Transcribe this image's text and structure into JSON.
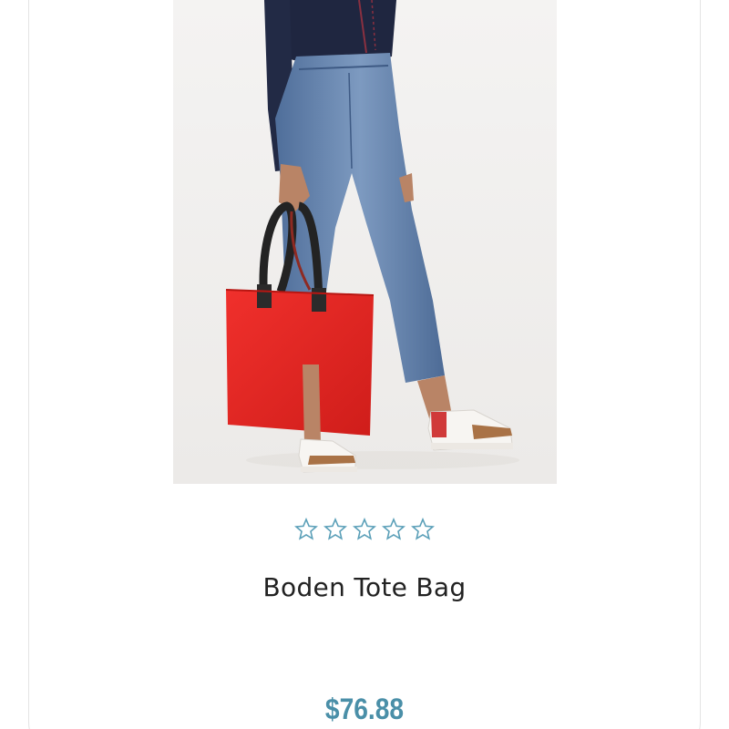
{
  "product": {
    "name": "Boden Tote Bag",
    "price": "$76.88",
    "image_icon": "product-photo",
    "rating": {
      "stars_total": 5,
      "stars_filled": 0,
      "star_icon": "star-outline-icon"
    }
  },
  "colors": {
    "star": "#5a9fb8",
    "price": "#4a8fa8",
    "title": "#222222",
    "card_border": "#e3e3e3"
  }
}
